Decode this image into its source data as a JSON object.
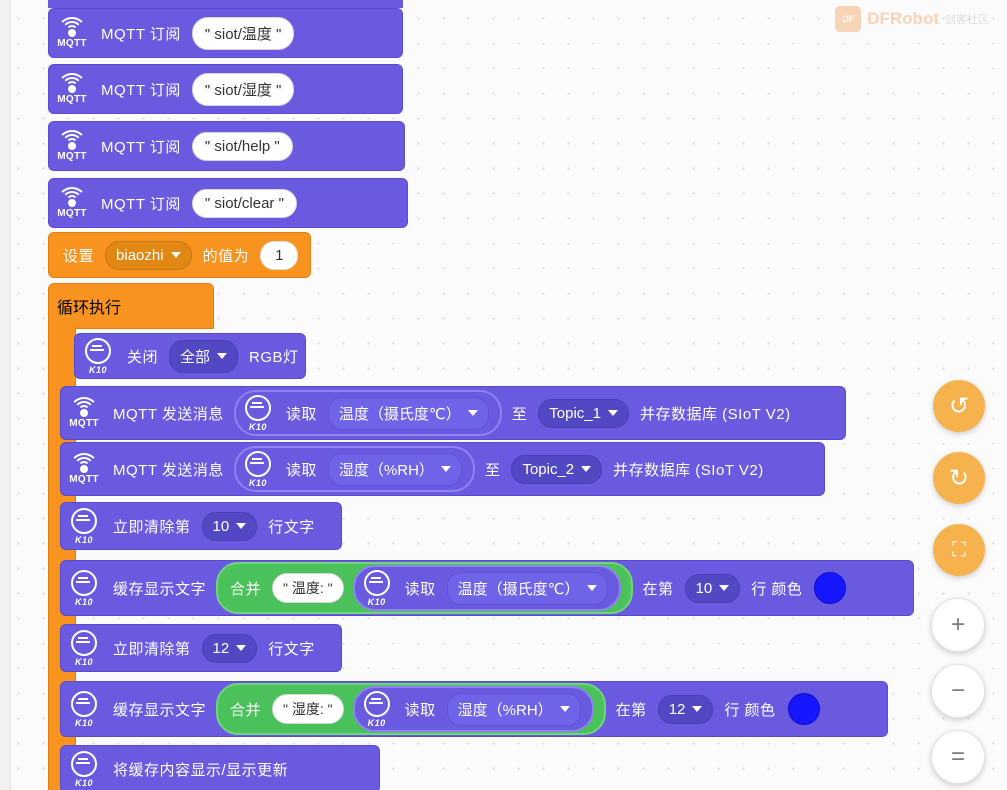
{
  "app": {
    "watermark_brand": "DF",
    "watermark_text": "DFRobot",
    "watermark_sub": "创客社区"
  },
  "toolbar": {
    "items": [
      {
        "name": "undo-button",
        "glyph": "↺"
      },
      {
        "name": "redo-button",
        "glyph": "↻"
      },
      {
        "name": "crop-button",
        "glyph": "⛶"
      },
      {
        "name": "zoom-in-button",
        "glyph": "+"
      },
      {
        "name": "zoom-out-button",
        "glyph": "−"
      },
      {
        "name": "zoom-reset-button",
        "glyph": "="
      }
    ]
  },
  "blocks": {
    "mqtt_subscribe_label": "MQTT 订阅",
    "subscriptions": [
      {
        "topic": "\" siot/温度 \""
      },
      {
        "topic": "\" siot/湿度 \""
      },
      {
        "topic": "\" siot/help \""
      },
      {
        "topic": "\" siot/clear \""
      }
    ],
    "set_var": {
      "prefix": "设置",
      "variable": "biaozhi",
      "middle": "的值为",
      "value": "1"
    },
    "loop": {
      "label": "循环执行"
    },
    "rgb_off": {
      "prefix": "关闭",
      "scope": "全部",
      "suffix": "RGB灯"
    },
    "mqtt_send_1": {
      "label": "MQTT 发送消息",
      "read_label": "读取",
      "sensor": "温度（摄氏度℃）",
      "to_label": "至",
      "topic": "Topic_1",
      "store_label": "并存数据库 (SIoT V2)"
    },
    "mqtt_send_2": {
      "label": "MQTT 发送消息",
      "read_label": "读取",
      "sensor": "湿度（%RH）",
      "to_label": "至",
      "topic": "Topic_2",
      "store_label": "并存数据库 (SIoT V2)"
    },
    "clear_line_1": {
      "prefix": "立即清除第",
      "line": "10",
      "suffix": "行文字"
    },
    "display_cache_1": {
      "prefix": "缓存显示文字",
      "join_label": "合并",
      "text": "\" 温度: \"",
      "read_label": "读取",
      "sensor": "温度（摄氏度℃）",
      "at_label": "在第",
      "line": "10",
      "row_label": "行 颜色",
      "color": "#1616ff"
    },
    "clear_line_2": {
      "prefix": "立即清除第",
      "line": "12",
      "suffix": "行文字"
    },
    "display_cache_2": {
      "prefix": "缓存显示文字",
      "join_label": "合并",
      "text": "\" 湿度: \"",
      "read_label": "读取",
      "sensor": "湿度（%RH）",
      "at_label": "在第",
      "line": "12",
      "row_label": "行 颜色",
      "color": "#1616ff"
    },
    "refresh": {
      "label": "将缓存内容显示/显示更新"
    },
    "icon_labels": {
      "mqtt": "MQTT",
      "k10": "K10"
    }
  }
}
